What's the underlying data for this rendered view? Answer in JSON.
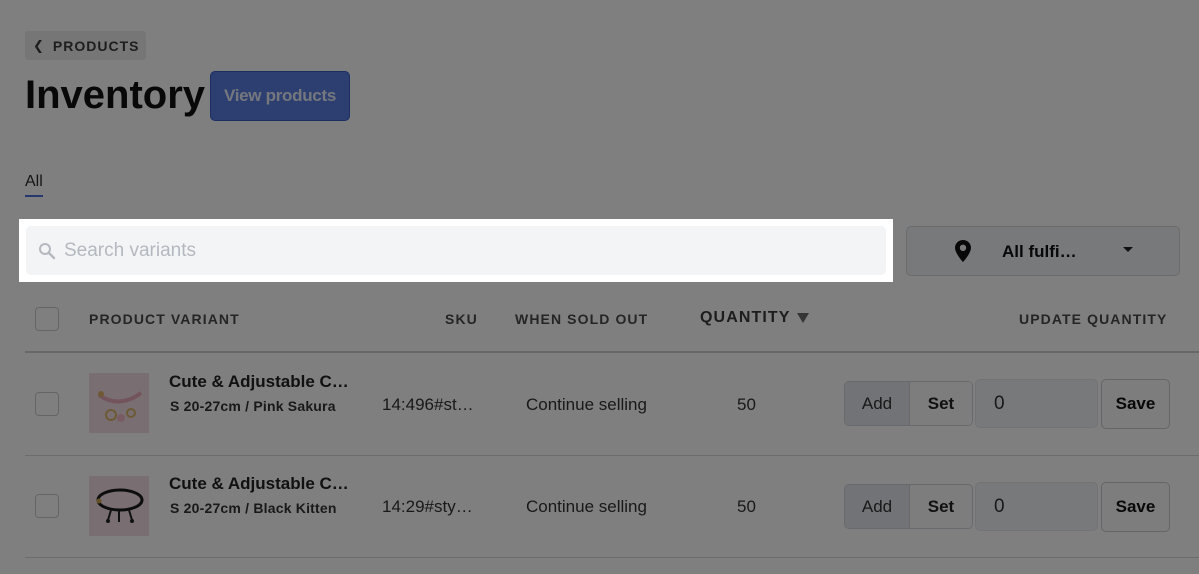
{
  "breadcrumb": {
    "label": "PRODUCTS"
  },
  "header": {
    "title": "Inventory",
    "view_products_label": "View products"
  },
  "tabs": [
    {
      "label": "All"
    }
  ],
  "search": {
    "placeholder": "Search variants",
    "value": ""
  },
  "location_filter": {
    "label": "All fulfi…"
  },
  "table": {
    "headers": {
      "product_variant": "PRODUCT VARIANT",
      "sku": "SKU",
      "when_sold_out": "WHEN SOLD OUT",
      "quantity": "QUANTITY",
      "update_quantity": "UPDATE QUANTITY"
    },
    "rows": [
      {
        "name": "Cute & Adjustable C…",
        "variant": "S 20-27cm / Pink Sakura",
        "sku": "14:496#st…",
        "when_sold_out": "Continue selling",
        "quantity": "50",
        "add_label": "Add",
        "set_label": "Set",
        "update_value": "0",
        "save_label": "Save"
      },
      {
        "name": "Cute & Adjustable C…",
        "variant": "S 20-27cm / Black Kitten",
        "sku": "14:29#sty…",
        "when_sold_out": "Continue selling",
        "quantity": "50",
        "add_label": "Add",
        "set_label": "Set",
        "update_value": "0",
        "save_label": "Save"
      }
    ]
  },
  "colors": {
    "accent": "#5b7fe0",
    "overlay": "rgba(0,0,0,0.5)"
  }
}
